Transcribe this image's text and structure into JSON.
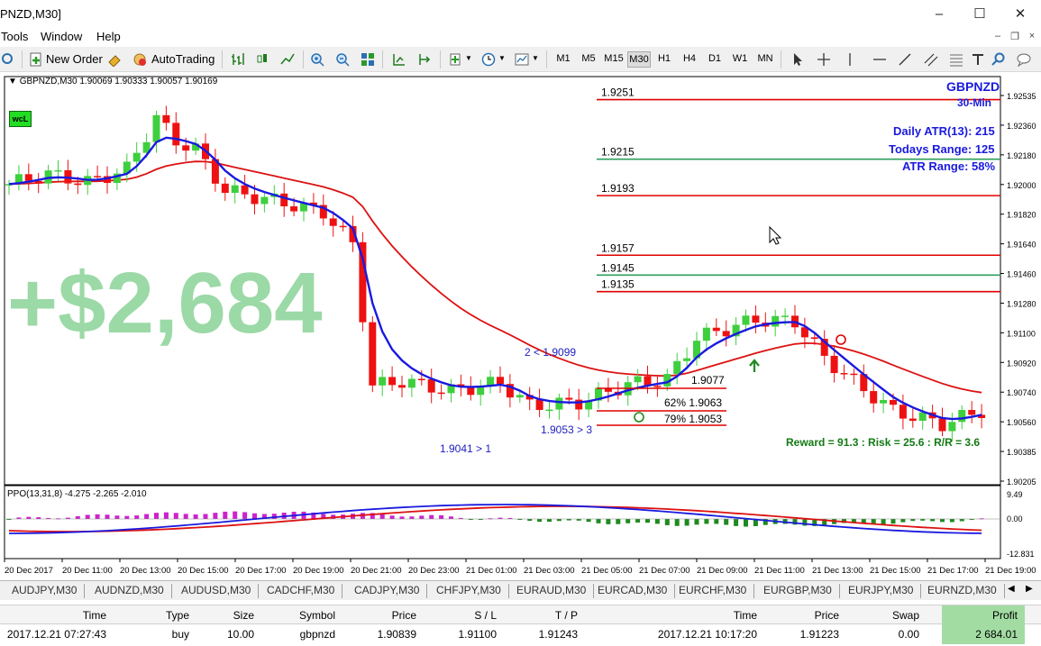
{
  "window": {
    "title": "PNZD,M30]"
  },
  "menu": [
    "Tools",
    "Window",
    "Help"
  ],
  "toolbar": {
    "new_order": "New Order",
    "autotrading": "AutoTrading",
    "timeframes": [
      "M1",
      "M5",
      "M15",
      "M30",
      "H1",
      "H4",
      "D1",
      "W1",
      "MN"
    ],
    "active_tf": "M30"
  },
  "chart": {
    "symbol_line": "GBPNZD,M30  1.90069 1.90333 1.90057 1.90169",
    "badge": "wcL",
    "watermark": "+$2,684",
    "info": {
      "symbol": "GBPNZD",
      "period": "30-Min",
      "atr": "Daily ATR(13): 215",
      "range": "Todays Range: 125",
      "atr_range": "ATR Range: 58%"
    },
    "levels": [
      {
        "label": "1.9251",
        "price": 1.9251,
        "color": "#e00000"
      },
      {
        "label": "1.9215",
        "price": 1.9215,
        "color": "#2e9e5e"
      },
      {
        "label": "1.9193",
        "price": 1.9193,
        "color": "#e00000"
      },
      {
        "label": "1.9157",
        "price": 1.9157,
        "color": "#e00000"
      },
      {
        "label": "1.9145",
        "price": 1.9145,
        "color": "#2e9e5e"
      },
      {
        "label": "1.9135",
        "price": 1.9135,
        "color": "#e00000"
      }
    ],
    "price_axis": [
      "1.92535",
      "1.92360",
      "1.92180",
      "1.92000",
      "1.91820",
      "1.91640",
      "1.91460",
      "1.91280",
      "1.91100",
      "1.90920",
      "1.90740",
      "1.90560",
      "1.90385",
      "1.90205"
    ],
    "annotations": {
      "a1": "2 < 1.9099",
      "a2": "1.9053 > 3",
      "a3": "1.9041 > 1",
      "fib1": "1.9077",
      "fib2": "62%  1.9063",
      "fib3": "79%  1.9053",
      "reward": "Reward = 91.3 : Risk = 25.6 : R/R = 3.6"
    },
    "ppo": {
      "label": "PPO(13,31,8) -4.275 -2.265 -2.010",
      "axis": [
        "9.49",
        "0.00",
        "-12.831"
      ]
    },
    "time_axis": [
      "20 Dec 2017",
      "20 Dec 11:00",
      "20 Dec 13:00",
      "20 Dec 15:00",
      "20 Dec 17:00",
      "20 Dec 19:00",
      "20 Dec 21:00",
      "20 Dec 23:00",
      "21 Dec 01:00",
      "21 Dec 03:00",
      "21 Dec 05:00",
      "21 Dec 07:00",
      "21 Dec 09:00",
      "21 Dec 11:00",
      "21 Dec 13:00",
      "21 Dec 15:00",
      "21 Dec 17:00",
      "21 Dec 19:00"
    ]
  },
  "tabs": [
    "AUDJPY,M30",
    "AUDNZD,M30",
    "AUDUSD,M30",
    "CADCHF,M30",
    "CADJPY,M30",
    "CHFJPY,M30",
    "EURAUD,M30",
    "EURCAD,M30",
    "EURCHF,M30",
    "EURGBP,M30",
    "EURJPY,M30",
    "EURNZD,M30"
  ],
  "terminal": {
    "headers": [
      "Time",
      "Type",
      "Size",
      "Symbol",
      "Price",
      "S / L",
      "T / P",
      "Time",
      "Price",
      "Swap",
      "Profit"
    ],
    "row": [
      "2017.12.21 07:27:43",
      "buy",
      "10.00",
      "gbpnzd",
      "1.90839",
      "1.91100",
      "1.91243",
      "2017.12.21 10:17:20",
      "1.91223",
      "0.00",
      "2 684.01"
    ]
  },
  "colors": {
    "bull": "#3ecf3e",
    "bear": "#ee1111",
    "ema_fast": "#1a1adf",
    "ema_slow": "#dd1111",
    "fib_text": "#2020c0",
    "reward_text": "#127a12",
    "watermark": "#9bd9a6"
  }
}
